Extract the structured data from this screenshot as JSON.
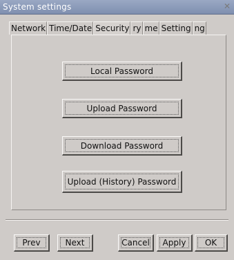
{
  "window": {
    "title": "System settings",
    "close_icon": "close-icon"
  },
  "tabs": [
    {
      "label": "Network"
    },
    {
      "label": "Time/Date"
    },
    {
      "label": "Security"
    },
    {
      "label": "ry"
    },
    {
      "label": "me"
    },
    {
      "label": "Setting"
    },
    {
      "label": "ng"
    }
  ],
  "active_tab": "Security",
  "security": {
    "local_password": "Local Password",
    "upload_password": "Upload Password",
    "download_password": "Download Password",
    "upload_history_password": "Upload (History) Password"
  },
  "footer": {
    "prev": "Prev",
    "next": "Next",
    "cancel": "Cancel",
    "apply": "Apply",
    "ok": "OK"
  }
}
